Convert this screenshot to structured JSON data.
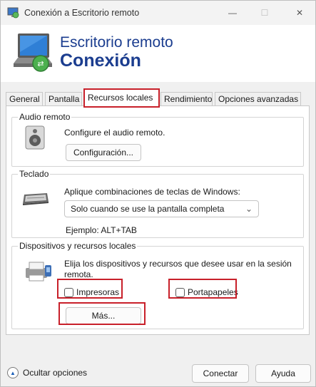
{
  "window": {
    "title": "Conexión a Escritorio remoto",
    "controls": {
      "minimize": "—",
      "maximize": "☐",
      "close": "✕"
    }
  },
  "header": {
    "line1": "Escritorio remoto",
    "line2": "Conexión",
    "icon": "remote-desktop-monitor-icon"
  },
  "tabs": [
    {
      "label": "General"
    },
    {
      "label": "Pantalla"
    },
    {
      "label": "Recursos locales",
      "active": true
    },
    {
      "label": "Rendimiento"
    },
    {
      "label": "Opciones avanzadas"
    }
  ],
  "audio": {
    "legend": "Audio remoto",
    "description": "Configure el audio remoto.",
    "button": "Configuración...",
    "icon": "speaker-icon"
  },
  "keyboard": {
    "legend": "Teclado",
    "description": "Aplique combinaciones de teclas de Windows:",
    "selected": "Solo cuando se use la pantalla completa",
    "example": "Ejemplo: ALT+TAB",
    "icon": "keyboard-icon"
  },
  "devices": {
    "legend": "Dispositivos y recursos locales",
    "description_line1": "Elija los dispositivos y recursos que desee usar en la sesión",
    "description_line2": "remota.",
    "printers_label": "Impresoras",
    "printers_checked": false,
    "clipboard_label": "Portapapeles",
    "clipboard_checked": false,
    "more_button": "Más...",
    "icon": "printer-devices-icon"
  },
  "footer": {
    "hide_options": "Ocultar opciones",
    "connect": "Conectar",
    "help": "Ayuda"
  },
  "colors": {
    "highlight": "#c8202a",
    "header_text": "#1b3d8f"
  }
}
